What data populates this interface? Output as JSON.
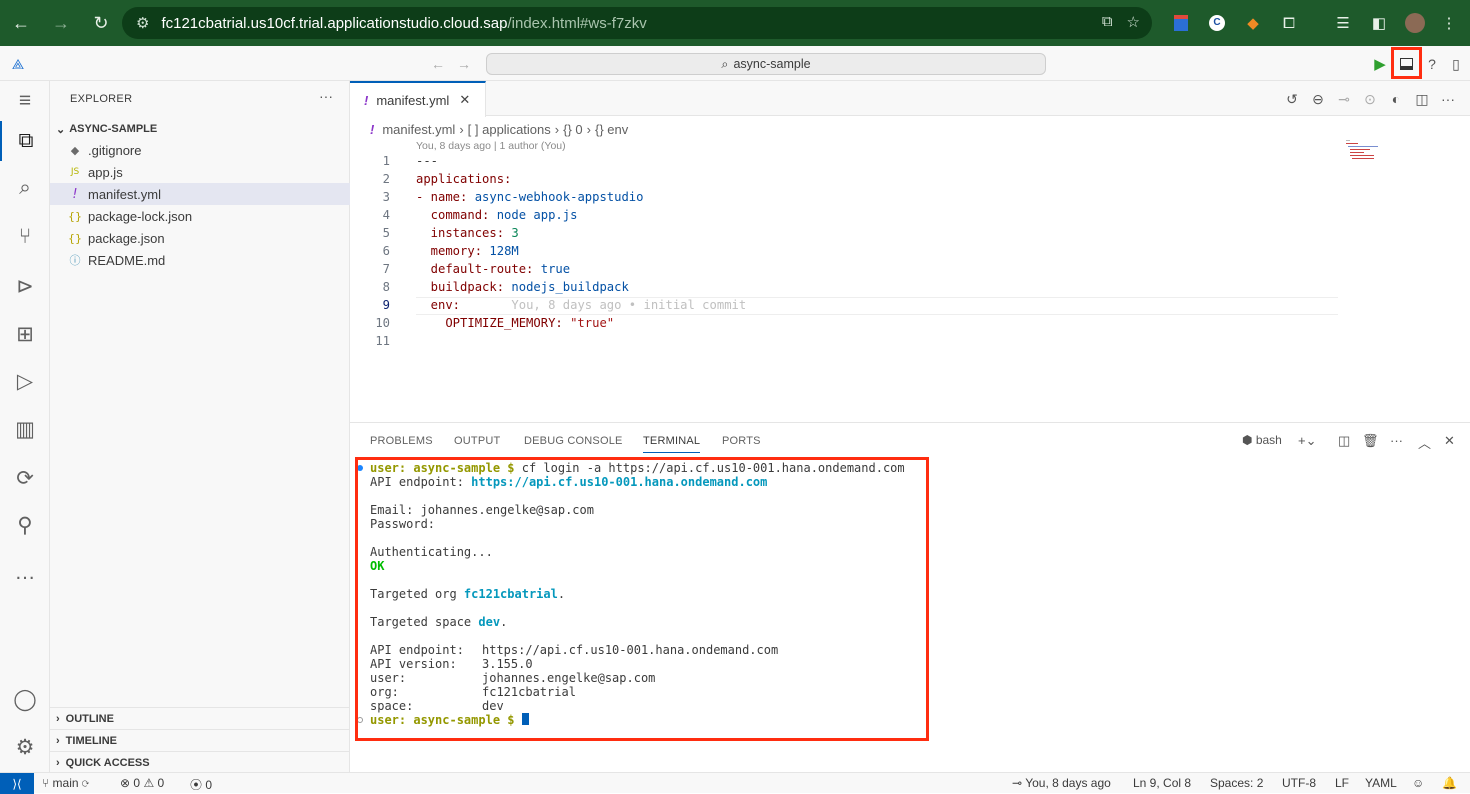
{
  "browser": {
    "url_host": "fc121cbatrial.us10cf.trial.applicationstudio.cloud.sap",
    "url_path": "/index.html#ws-f7zkv"
  },
  "titlebar": {
    "search_label": "async-sample"
  },
  "explorer": {
    "title": "EXPLORER",
    "folder": "ASYNC-SAMPLE",
    "files": [
      {
        "icon": "◆",
        "name": ".gitignore",
        "color": "#6b6b6b"
      },
      {
        "icon": "JS",
        "name": "app.js",
        "color": "#cbcb41"
      },
      {
        "icon": "!",
        "name": "manifest.yml",
        "color": "#8b35c9"
      },
      {
        "icon": "{}",
        "name": "package-lock.json",
        "color": "#cbcb41"
      },
      {
        "icon": "{}",
        "name": "package.json",
        "color": "#cbcb41"
      },
      {
        "icon": "ⓘ",
        "name": "README.md",
        "color": "#519aba"
      }
    ],
    "sections": [
      "OUTLINE",
      "TIMELINE",
      "QUICK ACCESS"
    ]
  },
  "editor": {
    "tab_label": "manifest.yml",
    "breadcrumb": [
      "manifest.yml",
      "[ ] applications",
      "{} 0",
      "{} env"
    ],
    "blame_header": "You, 8 days ago | 1 author (You)",
    "lines": [
      {
        "n": "1",
        "key": "---",
        "val": ""
      },
      {
        "n": "2",
        "key": "applications:",
        "val": ""
      },
      {
        "n": "3",
        "key": "- name:",
        "val": "async-webhook-appstudio"
      },
      {
        "n": "4",
        "key": "  command:",
        "val": "node app.js"
      },
      {
        "n": "5",
        "key": "  instances:",
        "val": "3"
      },
      {
        "n": "6",
        "key": "  memory:",
        "val": "128M"
      },
      {
        "n": "7",
        "key": "  default-route:",
        "val": "true"
      },
      {
        "n": "8",
        "key": "  buildpack:",
        "val": "nodejs_buildpack"
      },
      {
        "n": "9",
        "key": "  env:",
        "val": ""
      },
      {
        "n": "10",
        "key": "    OPTIMIZE_MEMORY:",
        "val": "\"true\""
      },
      {
        "n": "11",
        "key": "",
        "val": ""
      }
    ],
    "inline_blame": "You, 8 days ago • initial commit"
  },
  "panel": {
    "tabs": [
      "PROBLEMS",
      "OUTPUT",
      "DEBUG CONSOLE",
      "TERMINAL",
      "PORTS"
    ],
    "active_tab": "TERMINAL",
    "shell": "bash"
  },
  "terminal": {
    "prompt": "user: async-sample $",
    "cmd": " cf login -a https://api.cf.us10-001.hana.ondemand.com",
    "api_label": "API endpoint:",
    "api_url": "https://api.cf.us10-001.hana.ondemand.com",
    "email": "Email: johannes.engelke@sap.com",
    "password": "Password:",
    "auth": "Authenticating...",
    "ok": "OK",
    "org_label": "Targeted org ",
    "org": "fc121cbatrial",
    "space_label": "Targeted space ",
    "space": "dev",
    "info": [
      {
        "k": "API endpoint:",
        "v": "https://api.cf.us10-001.hana.ondemand.com"
      },
      {
        "k": "API version:",
        "v": "3.155.0"
      },
      {
        "k": "user:",
        "v": "johannes.engelke@sap.com"
      },
      {
        "k": "org:",
        "v": "fc121cbatrial"
      },
      {
        "k": "space:",
        "v": "dev"
      }
    ]
  },
  "statusbar": {
    "branch": "main",
    "errors": "0",
    "warnings": "0",
    "ports": "0",
    "blame": "You, 8 days ago",
    "position": "Ln 9, Col 8",
    "spaces": "Spaces: 2",
    "encoding": "UTF-8",
    "eol": "LF",
    "language": "YAML"
  },
  "colors": {
    "accent": "#005fb8",
    "highlight": "#ff2d10",
    "browser_bar": "#1e5a2b"
  }
}
